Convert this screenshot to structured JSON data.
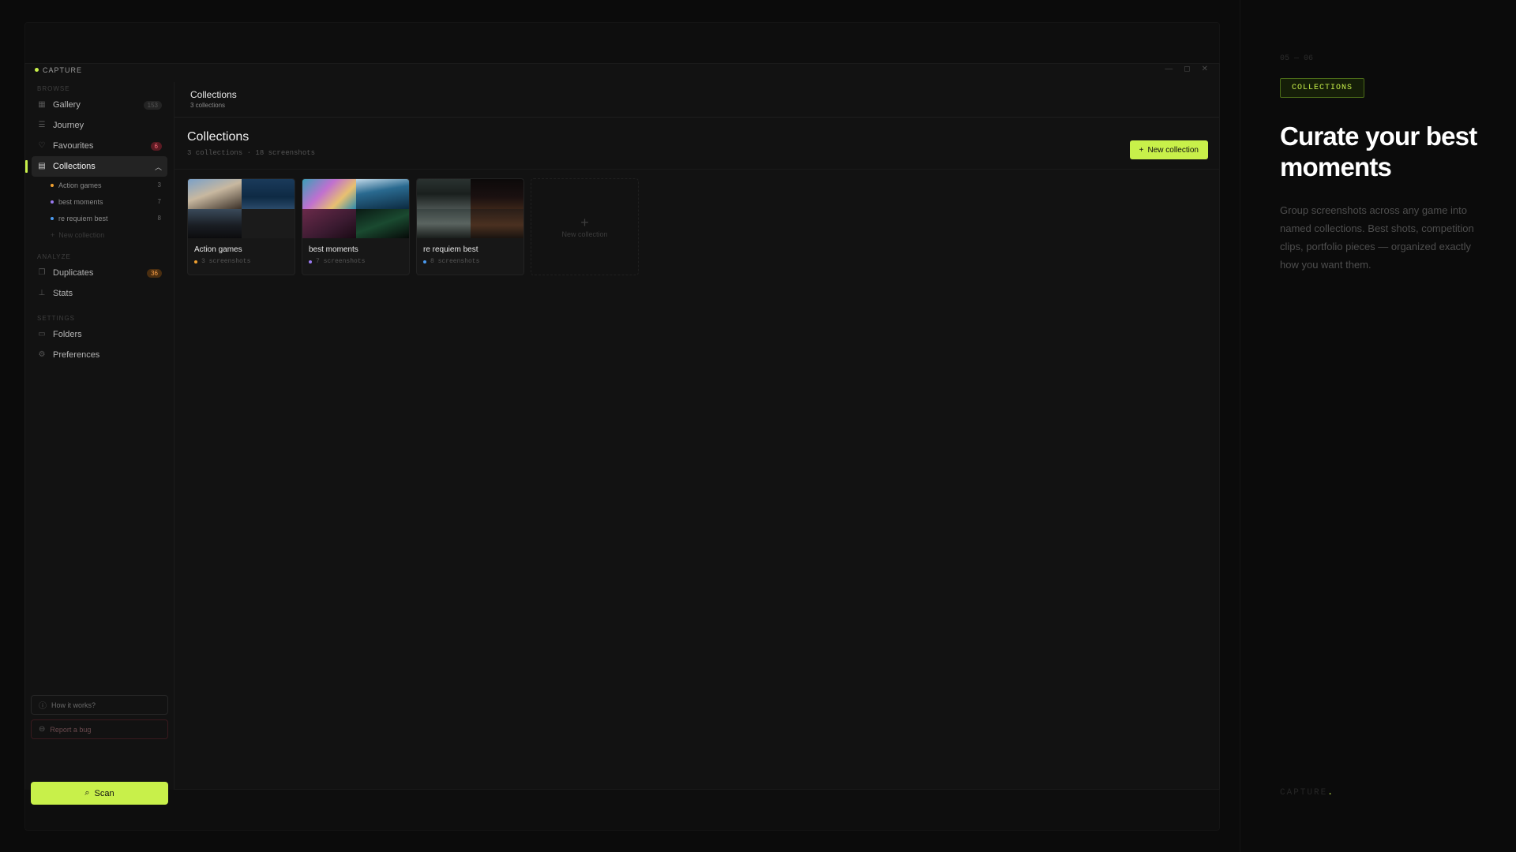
{
  "app": {
    "brand": "CAPTURE"
  },
  "sidebar": {
    "sections": {
      "browse": "BROWSE",
      "analyze": "ANALYZE",
      "settings": "SETTINGS"
    },
    "items": {
      "gallery": {
        "label": "Gallery",
        "badge": "153",
        "icon": "grid-icon"
      },
      "journey": {
        "label": "Journey",
        "icon": "list-icon"
      },
      "favourites": {
        "label": "Favourites",
        "badge": "6",
        "icon": "heart-icon"
      },
      "collections": {
        "label": "Collections",
        "icon": "folder-stack-icon"
      },
      "duplicates": {
        "label": "Duplicates",
        "badge": "36",
        "icon": "copy-icon"
      },
      "stats": {
        "label": "Stats",
        "icon": "bar-chart-icon"
      },
      "folders": {
        "label": "Folders",
        "icon": "folder-icon"
      },
      "preferences": {
        "label": "Preferences",
        "icon": "gear-icon"
      }
    },
    "sub_collections": [
      {
        "label": "Action games",
        "count": "3",
        "color": "#f0a030"
      },
      {
        "label": "best moments",
        "count": "7",
        "color": "#9a7af0"
      },
      {
        "label": "re requiem best",
        "count": "8",
        "color": "#4a9af0"
      }
    ],
    "new_collection": "New collection",
    "help": "How it works?",
    "bug": "Report a bug",
    "scan": "Scan"
  },
  "header": {
    "title": "Collections",
    "subtitle": "3 collections"
  },
  "page": {
    "title": "Collections",
    "summary": "3 collections · 18 screenshots",
    "new_button": "New collection"
  },
  "collections": [
    {
      "name": "Action games",
      "meta": "3 screenshots",
      "color": "#f0a030"
    },
    {
      "name": "best moments",
      "meta": "7 screenshots",
      "color": "#9a7af0"
    },
    {
      "name": "re requiem best",
      "meta": "8 screenshots",
      "color": "#4a9af0"
    }
  ],
  "new_card": "New collection",
  "panel": {
    "step": "05 — 06",
    "tag": "COLLECTIONS",
    "headline": "Curate your best moments",
    "description": "Group screenshots across any game into named collections. Best shots, competition clips, portfolio pieces — organized exactly how you want them.",
    "footer": "CAPTURE",
    "footer_dot": "."
  },
  "colors": {
    "accent": "#c8f04a",
    "background": "#0b0b0b"
  }
}
